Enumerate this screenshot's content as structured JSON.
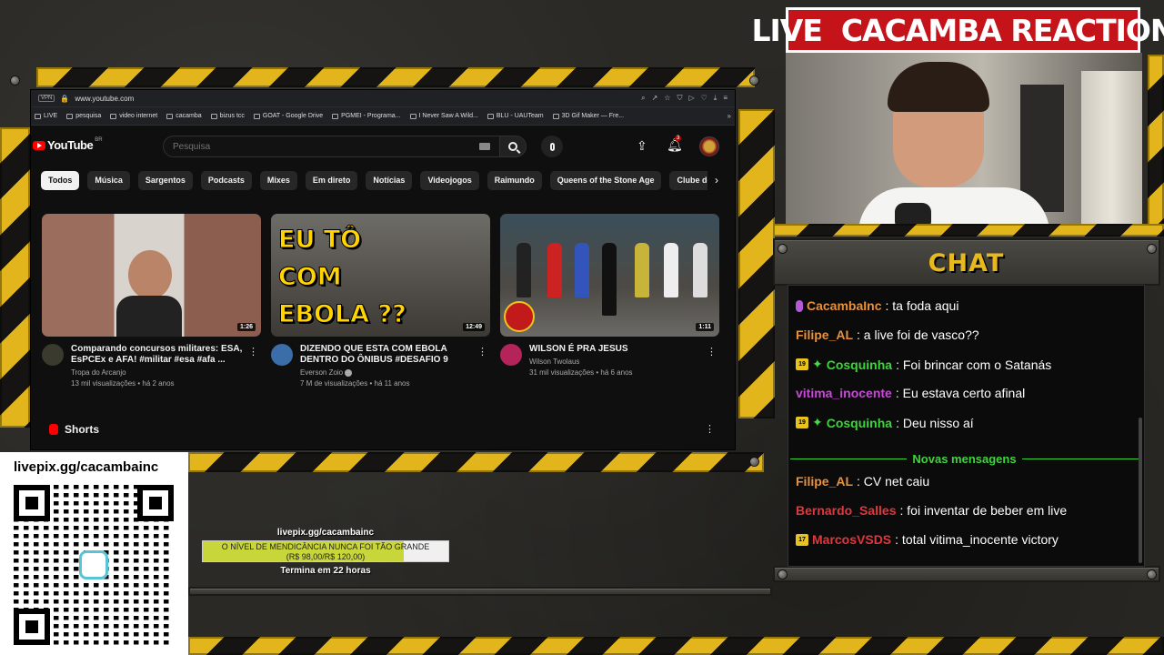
{
  "browser": {
    "vpn_label": "VPN",
    "url": "www.youtube.com",
    "bookmarks": [
      "LIVE",
      "pesquisa",
      "video internet",
      "cacamba",
      "bizus tcc",
      "GOAT - Google Drive",
      "PGMEI - Programa...",
      "I Never Saw A Wild...",
      "BLU - UAUTeam",
      "3D Gif Maker — Fre..."
    ]
  },
  "youtube": {
    "logo_text": "YouTube",
    "region": "BR",
    "search_placeholder": "Pesquisa",
    "notification_count": "3",
    "chips": [
      "Todos",
      "Música",
      "Sargentos",
      "Podcasts",
      "Mixes",
      "Em direto",
      "Notícias",
      "Videojogos",
      "Raimundo",
      "Queens of the Stone Age",
      "Clube de R"
    ],
    "videos": [
      {
        "title": "Comparando concursos militares: ESA, EsPCEx e AFA! #militar #esa #afa ...",
        "channel": "Tropa do Arcanjo",
        "stats": "13 mil visualizações • há 2 anos",
        "duration": "1:26",
        "avatar_color": "#3a3a2e"
      },
      {
        "title": "DIZENDO QUE ESTA COM EBOLA DENTRO DO ÔNIBUS #DESAFIO 9",
        "channel": "Everson Zoio",
        "stats": "7 M de visualizações • há 11 anos",
        "duration": "12:49",
        "thumb_text": "EU TÔ COM EBOLA ??",
        "avatar_color": "#3b6ea8"
      },
      {
        "title": "WILSON É PRA JESUS",
        "channel": "Wilson Twolaus",
        "stats": "31 mil visualizações • há 6 anos",
        "duration": "1:11",
        "avatar_color": "#b4245a"
      }
    ],
    "shorts_label": "Shorts"
  },
  "stream": {
    "banner": "LIVE  CACAMBA REACTION",
    "chat_title": "CHAT",
    "new_messages_label": "Novas mensagens",
    "messages": [
      {
        "user": "CacambaInc",
        "text": ": ta foda aqui",
        "color": "#e8913a",
        "badges": [
          "mic"
        ]
      },
      {
        "user": "Filipe_AL",
        "text": ": a live foi de vasco??",
        "color": "#e8913a",
        "badges": []
      },
      {
        "user": "Cosquinha",
        "text": ": Foi brincar com o Satanás",
        "color": "#3cd63c",
        "badges": [
          "19",
          "star"
        ]
      },
      {
        "user": "vitima_inocente",
        "text": ": Eu estava certo afinal",
        "color": "#c64bd6",
        "badges": []
      },
      {
        "user": "Cosquinha",
        "text": ": Deu nisso aí",
        "color": "#3cd63c",
        "badges": [
          "19",
          "star"
        ]
      },
      {
        "user": "Filipe_AL",
        "text": ": CV net caiu",
        "color": "#e8913a",
        "badges": []
      },
      {
        "user": "Bernardo_Salles",
        "text": ": foi inventar de beber em live",
        "color": "#e0373c",
        "badges": []
      },
      {
        "user": "MarcosVSDS",
        "text": ": total vitima_inocente victory",
        "color": "#e0373c",
        "badges": [
          "17"
        ]
      }
    ],
    "donation_url": "livepix.gg/cacambainc",
    "goal": {
      "url": "livepix.gg/cacambainc",
      "line1": "O NÍVEL DE MENDICÂNCIA NUNCA FOI TÃO GRANDE",
      "line2": "(R$ 98,00/R$ 120,00)",
      "progress": 0.82,
      "ends": "Termina em 22 horas"
    },
    "colors": {
      "hazard_yellow": "#e1b51b",
      "banner_red": "#c4141a",
      "chat_gold": "#e8b91f",
      "new_msg_green": "#3cd63c",
      "yt_red": "#ff0000"
    }
  }
}
